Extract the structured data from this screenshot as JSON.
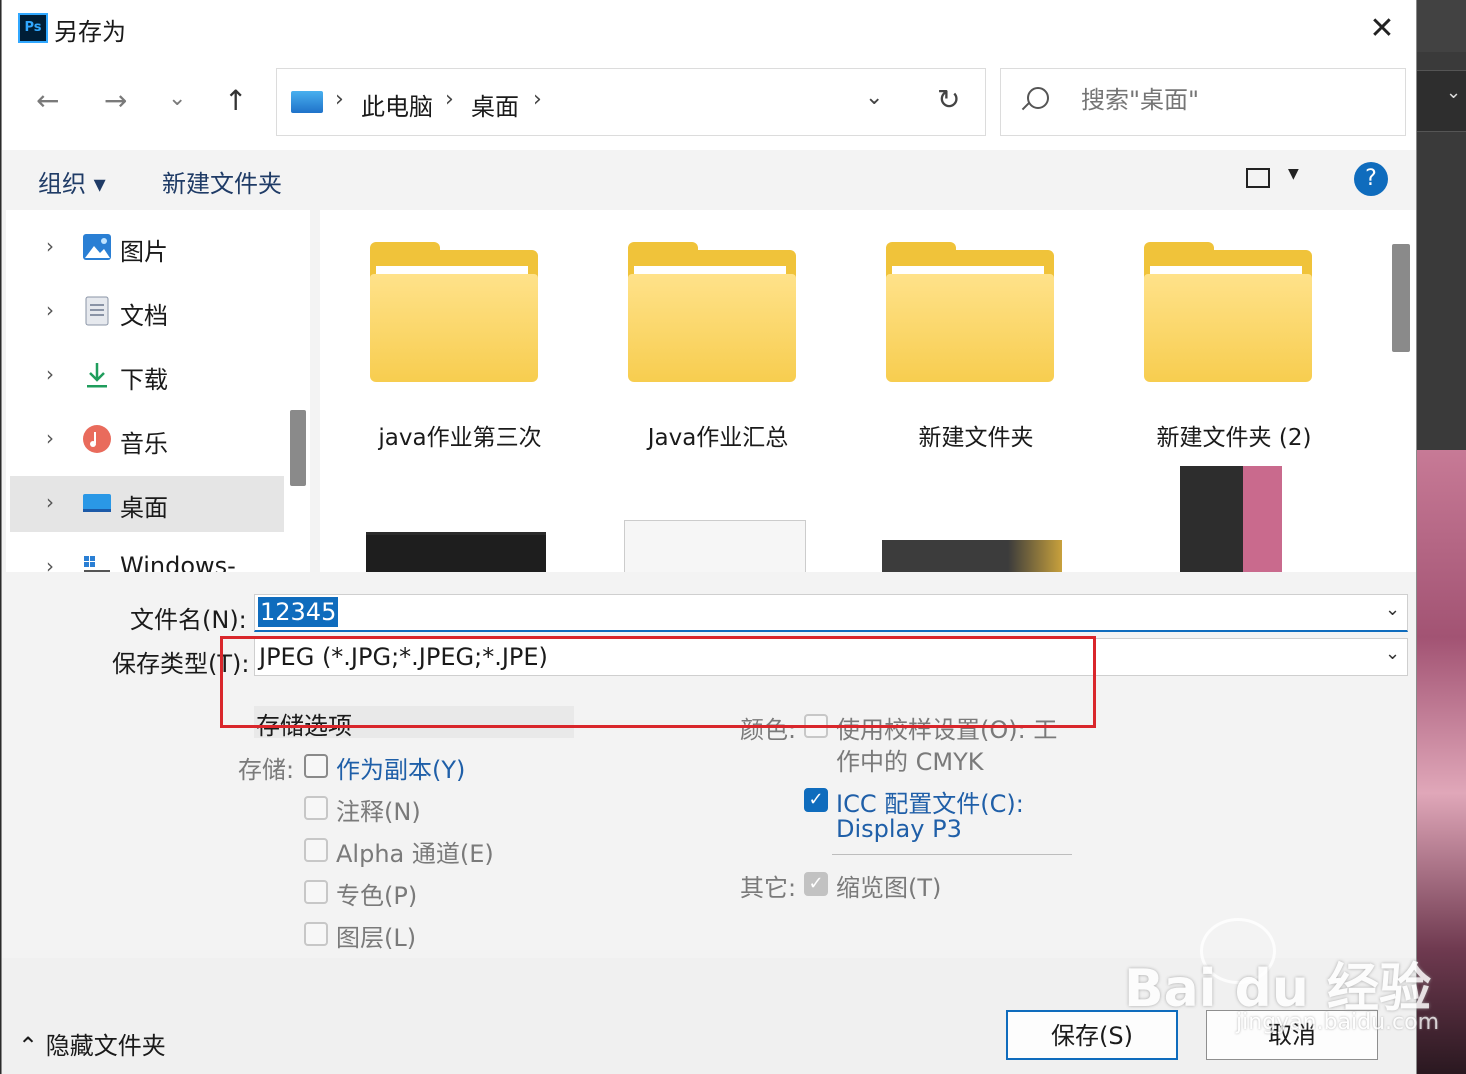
{
  "window": {
    "title": "另存为",
    "app_icon_text": "Ps",
    "close_symbol": "✕"
  },
  "nav": {
    "back": "←",
    "forward": "→",
    "recent": "⌄",
    "up": "↑",
    "breadcrumb": [
      "此电脑",
      "桌面"
    ],
    "crumb_sep": "›",
    "dropdown": "⌄",
    "refresh": "↻"
  },
  "search": {
    "placeholder": "搜索\"桌面\""
  },
  "toolbar": {
    "organize": "组织 ▾",
    "new_folder": "新建文件夹",
    "view_dd": "▼",
    "help": "?"
  },
  "sidebar": {
    "items": [
      {
        "label": "图片",
        "icon": "pictures-icon"
      },
      {
        "label": "文档",
        "icon": "documents-icon"
      },
      {
        "label": "下载",
        "icon": "downloads-icon"
      },
      {
        "label": "音乐",
        "icon": "music-icon"
      },
      {
        "label": "桌面",
        "icon": "desktop-icon",
        "selected": true
      },
      {
        "label": "Windows-SSD",
        "icon": "drive-icon"
      }
    ],
    "chevron": "›"
  },
  "files": {
    "folders": [
      "java作业第三次",
      "Java作业汇总",
      "新建文件夹",
      "新建文件夹 (2)"
    ]
  },
  "form": {
    "filename_label": "文件名(N):",
    "filename_value": "12345",
    "filetype_label": "保存类型(T):",
    "filetype_value": "JPEG (*.JPG;*.JPEG;*.JPE)",
    "dd": "⌄"
  },
  "options": {
    "header": "存储选项",
    "save_label": "存储:",
    "as_copy": "作为副本(Y)",
    "notes": "注释(N)",
    "alpha": "Alpha 通道(E)",
    "spot": "专色(P)",
    "layers": "图层(L)",
    "color_label": "颜色:",
    "proof": "使用校样设置(O): 工",
    "proof_line2": "作中的 CMYK",
    "icc": "ICC 配置文件(C):",
    "icc_line2": "Display P3",
    "other_label": "其它:",
    "thumbnail": "缩览图(T)",
    "check": "✓"
  },
  "footer": {
    "hide_folders": "⌃ 隐藏文件夹",
    "save": "保存(S)",
    "cancel": "取消"
  },
  "watermark": {
    "brand": "Bai du 经验",
    "url": "jingyan.baidu.com"
  },
  "colors": {
    "accent": "#0f6cbd",
    "highlight_box": "#d9262b",
    "folder": "#f7cd4f"
  }
}
